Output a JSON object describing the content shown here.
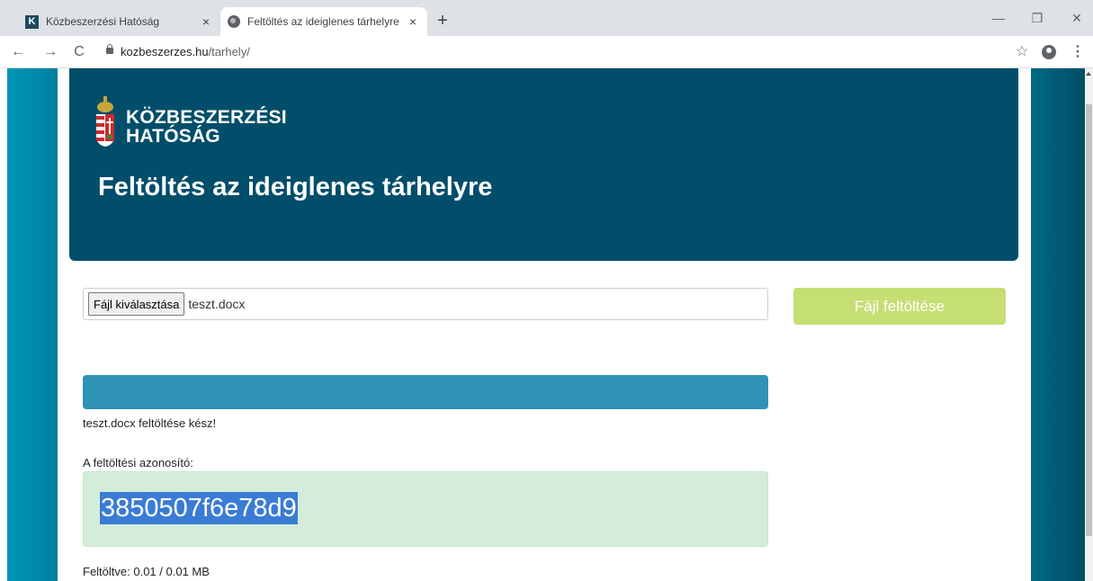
{
  "browser": {
    "tabs": [
      {
        "title": "Közbeszerzési Hatóság",
        "favicon_letter": "K"
      },
      {
        "title": "Feltöltés az ideiglenes tárhelyre"
      }
    ],
    "new_tab": "+",
    "close_glyph": "×",
    "url_host": "kozbeszerzes.hu",
    "url_path": "/tarhely/",
    "window_controls": {
      "minimize": "—",
      "restore": "❐",
      "close": "✕"
    },
    "nav": {
      "back": "←",
      "forward": "→",
      "reload": "C"
    },
    "bookmark_glyph": "☆",
    "menu_glyph": "⋮"
  },
  "header": {
    "logo_line1": "KÖZBESZERZÉSI",
    "logo_line2": "HATÓSÁG",
    "title": "Feltöltés az ideiglenes tárhelyre",
    "bg_color": "#004e6a"
  },
  "upload": {
    "choose_label": "Fájl kiválasztása",
    "file_name": "teszt.docx",
    "upload_label": "Fájl feltöltése",
    "button_color": "#c5df73"
  },
  "progress": {
    "percent": 100,
    "color": "#2f93b6"
  },
  "status": {
    "done_text": "teszt.docx feltöltése kész!",
    "id_label": "A feltöltési azonosító:",
    "id_value": "3850507f6e78d9",
    "uploaded_text": "Feltöltve: 0.01 / 0.01 MB"
  }
}
